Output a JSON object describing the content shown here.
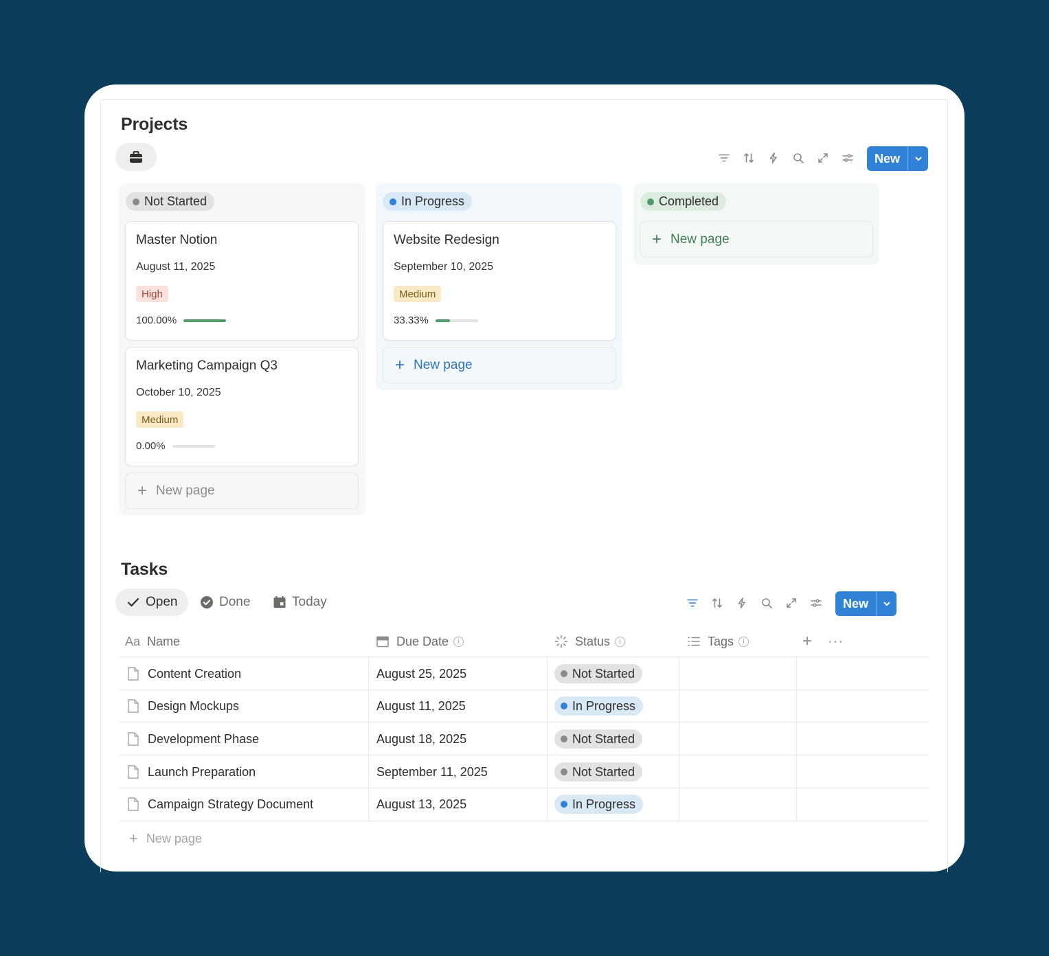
{
  "projects": {
    "title": "Projects",
    "toolbar": {
      "new_label": "New"
    },
    "columns": [
      {
        "status": "Not Started",
        "new_page_label": "New page",
        "cards": [
          {
            "title": "Master Notion",
            "date": "August 11, 2025",
            "priority": "High",
            "progress_label": "100.00%",
            "progress": 1.0
          },
          {
            "title": "Marketing Campaign Q3",
            "date": "October 10, 2025",
            "priority": "Medium",
            "progress_label": "0.00%",
            "progress": 0.0
          }
        ]
      },
      {
        "status": "In Progress",
        "new_page_label": "New page",
        "cards": [
          {
            "title": "Website Redesign",
            "date": "September 10, 2025",
            "priority": "Medium",
            "progress_label": "33.33%",
            "progress": 0.3333
          }
        ]
      },
      {
        "status": "Completed",
        "new_page_label": "New page",
        "cards": []
      }
    ]
  },
  "tasks": {
    "title": "Tasks",
    "tabs": [
      {
        "label": "Open",
        "active": true
      },
      {
        "label": "Done",
        "active": false
      },
      {
        "label": "Today",
        "active": false
      }
    ],
    "toolbar": {
      "new_label": "New"
    },
    "columns": {
      "name": "Name",
      "due": "Due Date",
      "status": "Status",
      "tags": "Tags",
      "name_type_glyph": "Aa"
    },
    "rows": [
      {
        "name": "Content Creation",
        "due": "August 25, 2025",
        "status": "Not Started"
      },
      {
        "name": "Design Mockups",
        "due": "August 11, 2025",
        "status": "In Progress"
      },
      {
        "name": "Development Phase",
        "due": "August 18, 2025",
        "status": "Not Started"
      },
      {
        "name": "Launch Preparation",
        "due": "September 11, 2025",
        "status": "Not Started"
      },
      {
        "name": "Campaign Strategy Document",
        "due": "August 13, 2025",
        "status": "In Progress"
      }
    ],
    "new_page_label": "New page"
  },
  "colors": {
    "background": "#0b3d5b",
    "accent": "#2f82d6",
    "progress_fill": "#4f9a67"
  }
}
